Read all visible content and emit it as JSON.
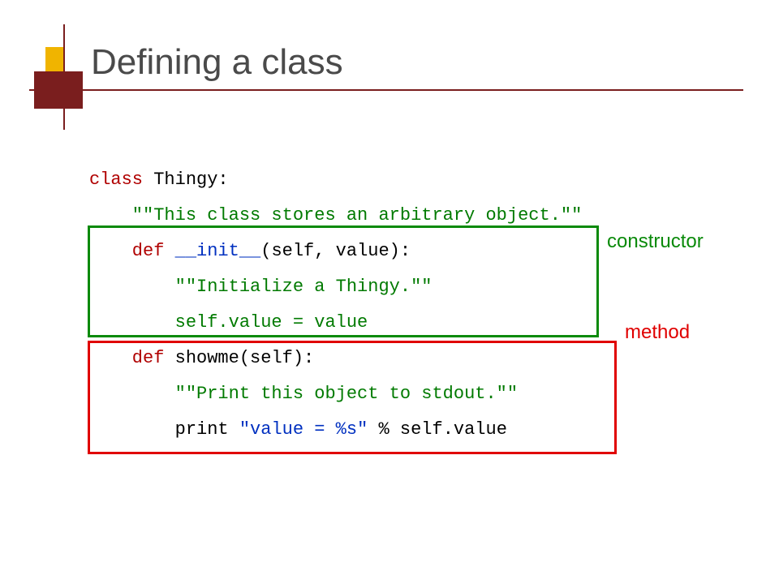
{
  "title": "Defining a class",
  "code": {
    "l1_kw": "class",
    "l1_rest": " Thingy:",
    "l2": "    \"\"This class stores an arbitrary object.\"\"",
    "l3_kw": "    def ",
    "l3_name": "__init__",
    "l3_rest": "(self, value):",
    "l4": "        \"\"Initialize a Thingy.\"\"",
    "l5": "        self.value = value",
    "l6_kw": "    def ",
    "l6_rest": "showme(self):",
    "l7": "        \"\"Print this object to stdout.\"\"",
    "l8_a": "        print ",
    "l8_b": "\"value = %s\"",
    "l8_c": " % self.value"
  },
  "labels": {
    "constructor": "constructor",
    "method": "method"
  }
}
